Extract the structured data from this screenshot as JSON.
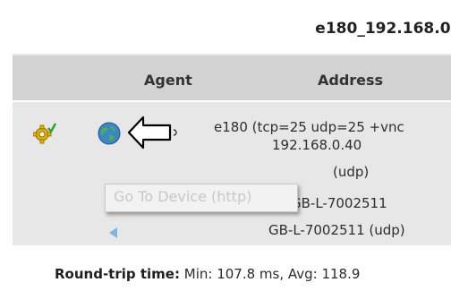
{
  "header": {
    "title": "e180_192.168.0."
  },
  "table": {
    "columns": [
      "Agent",
      "Address"
    ],
    "rows": [
      {
        "address_line1": "e180 (tcp=25 udp=25 +vnc",
        "address_line2": "192.168.0.40",
        "address_line3": "(udp)"
      },
      {
        "address": "GB-L-7002511"
      },
      {
        "address": "GB-L-7002511 (udp)"
      }
    ]
  },
  "tooltip": {
    "text": "Go To Device (http)"
  },
  "stats": {
    "label": "Round-trip time:",
    "value": "Min: 107.8 ms, Avg: 118.9"
  },
  "icons": {
    "status": "gear-check-icon",
    "device": "globe-icon",
    "pointer": "arrow-callout-icon",
    "row_indicator": "triangle-left-icon"
  },
  "colors": {
    "header_bg": "#d2d2d2",
    "panel_bg": "#e7e7e7",
    "accent_blue": "#7fb6e0",
    "gear_yellow": "#e0b400",
    "check_green": "#2e9e2e"
  }
}
